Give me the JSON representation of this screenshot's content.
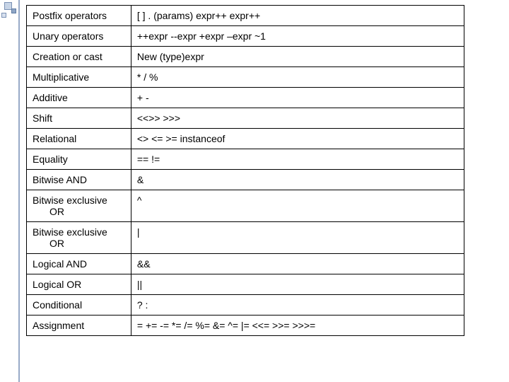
{
  "rows": [
    {
      "name": "Postfix operators",
      "ops": "[ ] . (params) expr++ expr++"
    },
    {
      "name": "Unary operators",
      "ops": "++expr --expr +expr –expr ~1"
    },
    {
      "name": "Creation or cast",
      "ops": "New (type)expr"
    },
    {
      "name": "Multiplicative",
      "ops": "* / %"
    },
    {
      "name": "Additive",
      "ops": "+ -"
    },
    {
      "name": "Shift",
      "ops": "<<>> >>>"
    },
    {
      "name": "Relational",
      "ops": "<> <= >= instanceof"
    },
    {
      "name": "Equality",
      "ops": "== !="
    },
    {
      "name": "Bitwise AND",
      "ops": "&"
    },
    {
      "name": "Bitwise exclusive",
      "name2": "OR",
      "ops": "^"
    },
    {
      "name": "Bitwise exclusive",
      "name2": "OR",
      "ops": "|"
    },
    {
      "name": "Logical AND",
      "ops": "&&"
    },
    {
      "name": "Logical OR",
      "ops": "||"
    },
    {
      "name": "Conditional",
      "ops": "? :"
    },
    {
      "name": "Assignment",
      "ops": "= += -= *= /= %= &= ^= |= <<= >>= >>>="
    }
  ]
}
